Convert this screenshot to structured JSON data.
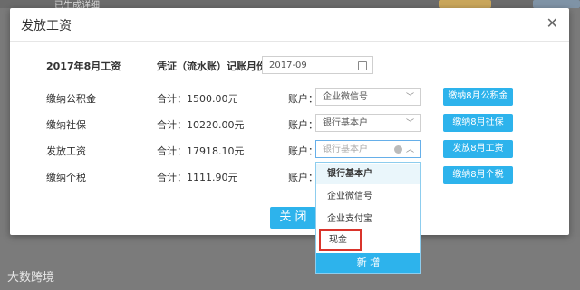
{
  "background": {
    "left_label": "已生成详细"
  },
  "dialog": {
    "title": "发放工资",
    "period_label": "2017年8月工资",
    "voucher_label": "凭证（流水账）记账月份：",
    "voucher_month": "2017-09",
    "close_button": "关 闭",
    "account_label": "账户：",
    "rows": [
      {
        "name": "缴纳公积金",
        "total": "合计：1500.00元",
        "account": "企业微信号",
        "action": "缴纳8月公积金"
      },
      {
        "name": "缴纳社保",
        "total": "合计：10220.00元",
        "account": "银行基本户",
        "action": "缴纳8月社保"
      },
      {
        "name": "发放工资",
        "total": "合计：17918.10元",
        "account": "银行基本户",
        "action": "发放8月工资"
      },
      {
        "name": "缴纳个税",
        "total": "合计：1111.90元",
        "account": "",
        "action": "缴纳8月个税"
      }
    ]
  },
  "dropdown": {
    "options": [
      "银行基本户",
      "企业微信号",
      "企业支付宝",
      "现金"
    ],
    "add_button": "新 增"
  },
  "watermark": "大数跨境",
  "colors": {
    "accent": "#2db3ec",
    "highlight_border": "#d9342b"
  }
}
